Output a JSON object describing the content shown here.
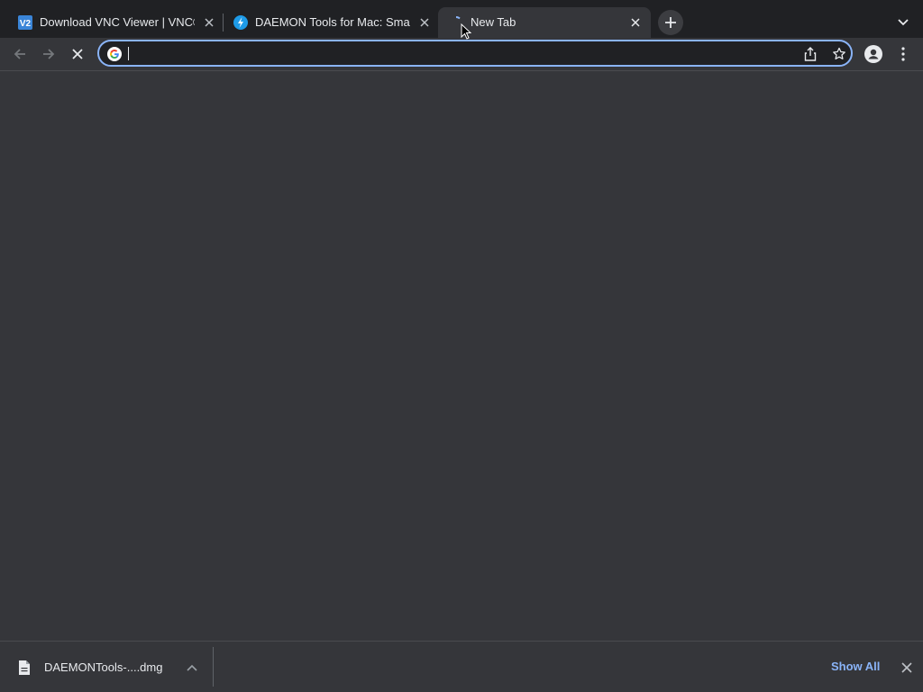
{
  "tabs": [
    {
      "title": "Download VNC Viewer | VNC®",
      "favicon": "vnc-icon",
      "active": false
    },
    {
      "title": "DAEMON Tools for Mac: Smart",
      "favicon": "daemon-tools-icon",
      "active": false
    },
    {
      "title": "New Tab",
      "favicon": "loading-spinner-icon",
      "active": true
    }
  ],
  "toolbar": {
    "omnibox_value": "",
    "omnibox_icon": "google-icon"
  },
  "downloads": {
    "items": [
      {
        "file_name": "DAEMONTools-....dmg",
        "icon": "file-icon"
      }
    ],
    "show_all_label": "Show All"
  },
  "colors": {
    "accent": "#8ab4f8",
    "tabstrip_bg": "#202124",
    "toolbar_bg": "#35363a"
  }
}
